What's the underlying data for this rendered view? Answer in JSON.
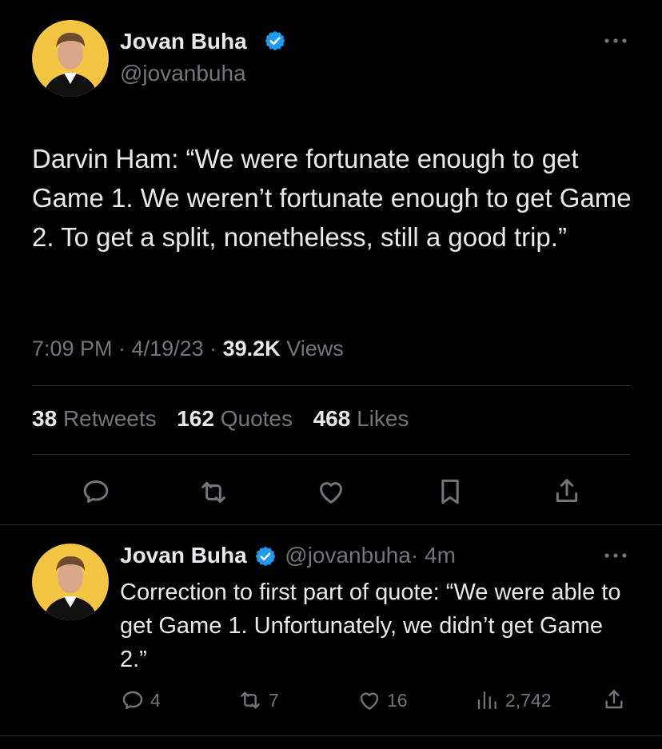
{
  "main_tweet": {
    "author_name": "Jovan Buha",
    "author_handle": "@jovanbuha",
    "text": "Darvin Ham: “We were fortunate enough to get Game 1. We weren’t fortunate enough to get Game 2. To get a split, nonetheless, still a good trip.”",
    "timestamp": "7:09 PM · 4/19/23 · ",
    "views_count": "39.2K",
    "views_label": " Views",
    "retweets_count": "38",
    "retweets_label": "Retweets",
    "quotes_count": "162",
    "quotes_label": "Quotes",
    "likes_count": "468",
    "likes_label": "Likes"
  },
  "reply_tweet": {
    "author_name": "Jovan Buha",
    "author_handle": "@jovanbuha",
    "time": "· 4m",
    "text": "Correction to first part of quote: “We were able to get Game 1. Unfortunately, we didn’t get Game 2.”",
    "replies": "4",
    "retweets": "7",
    "likes": "16",
    "views": "2,742"
  },
  "colors": {
    "background": "#000000",
    "text": "#e7e9ea",
    "muted": "#71767b",
    "verified": "#1d9bf0",
    "avatar_bg": "#f4c542"
  },
  "icons": [
    "more-icon",
    "verified-icon",
    "reply-icon",
    "retweet-icon",
    "like-icon",
    "bookmark-icon",
    "share-icon",
    "views-icon"
  ]
}
